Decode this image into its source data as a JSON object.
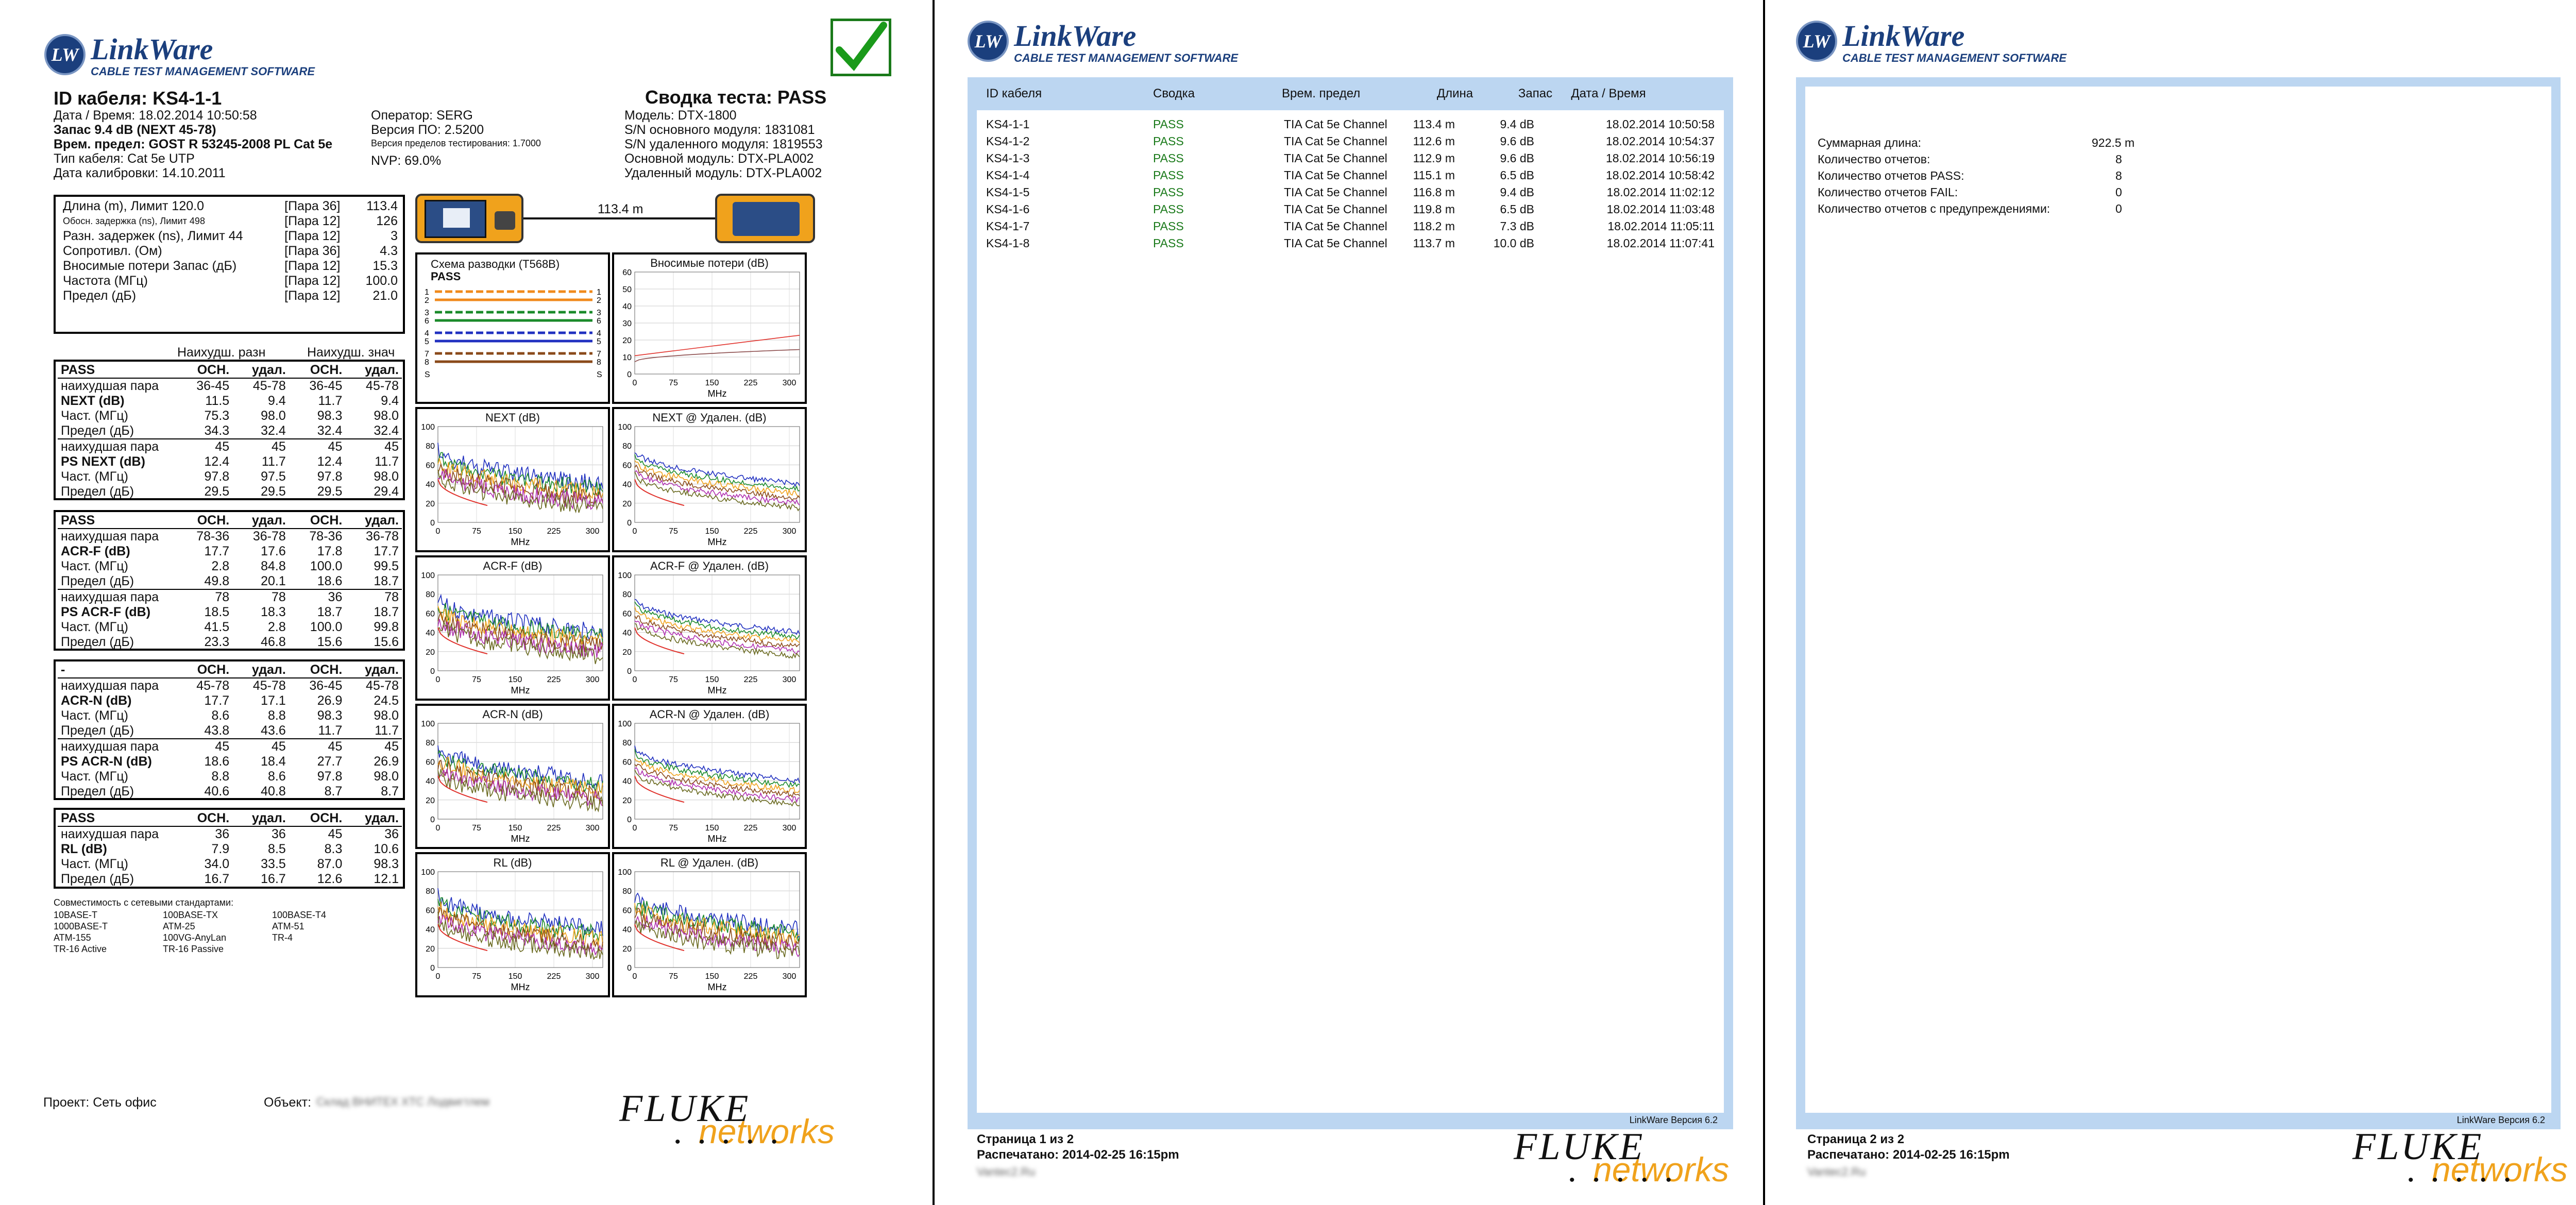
{
  "brand": {
    "name": "LinkWare",
    "logo_letters": "LW",
    "subtitle": "CABLE TEST MANAGEMENT SOFTWARE",
    "fluke": "FLUKE",
    "networks": "networks",
    "dots": "• • • • •"
  },
  "p1": {
    "cable_id": "ID кабеля: KS4-1-1",
    "datetime": "Дата / Время: 18.02.2014 10:50:58",
    "margin": "Запас 9.4 dB (NEXT 45-78)",
    "limit": "Врем. предел: GOST R 53245-2008 PL Cat 5e",
    "cable_type": "Тип кабеля: Cat 5e UTP",
    "cal_date": "Дата калибровки: 14.10.2011",
    "operator": "Оператор: SERG",
    "sw_ver": "Версия ПО: 2.5200",
    "limit_ver": "Версия пределов тестирования: 1.7000",
    "nvp": "NVP: 69.0%",
    "summary": "Сводка теста: PASS",
    "model": "Модель: DTX-1800",
    "main_sn": "S/N основного модуля: 1831081",
    "remote_sn": "S/N удаленного модуля: 1819553",
    "main_mod": "Основной модуль: DTX-PLA002",
    "remote_mod": "Удаленный модуль: DTX-PLA002",
    "length_label": "113.4 m",
    "summary_rows": [
      [
        "Длина (m), Лимит 120.0",
        "[Пара 36]",
        "113.4"
      ],
      [
        "Обосн. задержка (ns), Лимит 498",
        "[Пара 12]",
        "126"
      ],
      [
        "Разн. задержек (ns), Лимит 44",
        "[Пара 12]",
        "3"
      ],
      [
        "Сопротивл. (Ом)",
        "[Пара 36]",
        "4.3"
      ],
      [
        "",
        "",
        ""
      ],
      [
        "Вносимые потери Запас (дБ)",
        "[Пара 12]",
        "15.3"
      ],
      [
        "Частота (МГц)",
        "[Пара 12]",
        "100.0"
      ],
      [
        "Предел (дБ)",
        "[Пара 12]",
        "21.0"
      ]
    ],
    "worst_margin": "Наихудш. разн",
    "worst_value": "Наихудш. знач",
    "groups": [
      {
        "rows": [
          [
            "PASS",
            "ОСН.",
            "удал.",
            "ОСН.",
            "удал."
          ],
          [
            "наихудшая пара",
            "36-45",
            "45-78",
            "36-45",
            "45-78"
          ],
          [
            "NEXT (dB)",
            "11.5",
            "9.4",
            "11.7",
            "9.4"
          ],
          [
            "Част. (МГц)",
            "75.3",
            "98.0",
            "98.3",
            "98.0"
          ],
          [
            "Предел (дБ)",
            "34.3",
            "32.4",
            "32.4",
            "32.4"
          ],
          [
            "наихудшая пара",
            "45",
            "45",
            "45",
            "45"
          ],
          [
            "PS NEXT (dB)",
            "12.4",
            "11.7",
            "12.4",
            "11.7"
          ],
          [
            "Част. (МГц)",
            "97.8",
            "97.5",
            "97.8",
            "98.0"
          ],
          [
            "Предел (дБ)",
            "29.5",
            "29.5",
            "29.5",
            "29.4"
          ]
        ]
      },
      {
        "rows": [
          [
            "PASS",
            "ОСН.",
            "удал.",
            "ОСН.",
            "удал."
          ],
          [
            "наихудшая пара",
            "78-36",
            "36-78",
            "78-36",
            "36-78"
          ],
          [
            "ACR-F (dB)",
            "17.7",
            "17.6",
            "17.8",
            "17.7"
          ],
          [
            "Част. (МГц)",
            "2.8",
            "84.8",
            "100.0",
            "99.5"
          ],
          [
            "Предел (дБ)",
            "49.8",
            "20.1",
            "18.6",
            "18.7"
          ],
          [
            "наихудшая пара",
            "78",
            "78",
            "36",
            "78"
          ],
          [
            "PS ACR-F (dB)",
            "18.5",
            "18.3",
            "18.7",
            "18.7"
          ],
          [
            "Част. (МГц)",
            "41.5",
            "2.8",
            "100.0",
            "99.8"
          ],
          [
            "Предел (дБ)",
            "23.3",
            "46.8",
            "15.6",
            "15.6"
          ]
        ]
      },
      {
        "rows": [
          [
            "-",
            "ОСН.",
            "удал.",
            "ОСН.",
            "удал."
          ],
          [
            "наихудшая пара",
            "45-78",
            "45-78",
            "36-45",
            "45-78"
          ],
          [
            "ACR-N (dB)",
            "17.7",
            "17.1",
            "26.9",
            "24.5"
          ],
          [
            "Част. (МГц)",
            "8.6",
            "8.8",
            "98.3",
            "98.0"
          ],
          [
            "Предел (дБ)",
            "43.8",
            "43.6",
            "11.7",
            "11.7"
          ],
          [
            "наихудшая пара",
            "45",
            "45",
            "45",
            "45"
          ],
          [
            "PS ACR-N (dB)",
            "18.6",
            "18.4",
            "27.7",
            "26.9"
          ],
          [
            "Част. (МГц)",
            "8.8",
            "8.6",
            "97.8",
            "98.0"
          ],
          [
            "Предел (дБ)",
            "40.6",
            "40.8",
            "8.7",
            "8.7"
          ]
        ]
      },
      {
        "rows": [
          [
            "PASS",
            "ОСН.",
            "удал.",
            "ОСН.",
            "удал."
          ],
          [
            "наихудшая пара",
            "36",
            "36",
            "45",
            "36"
          ],
          [
            "RL (dB)",
            "7.9",
            "8.5",
            "8.3",
            "10.6"
          ],
          [
            "Част. (МГц)",
            "34.0",
            "33.5",
            "87.0",
            "98.3"
          ],
          [
            "Предел (дБ)",
            "16.7",
            "16.7",
            "12.6",
            "12.1"
          ]
        ]
      }
    ],
    "compat_title": "Совместимость с сетевыми стандартами:",
    "compat": [
      [
        "10BASE-T",
        "100BASE-TX",
        "100BASE-T4"
      ],
      [
        "1000BASE-T",
        "ATM-25",
        "ATM-51"
      ],
      [
        "ATM-155",
        "100VG-AnyLan",
        "TR-4"
      ],
      [
        "TR-16 Active",
        "TR-16 Passive",
        ""
      ]
    ],
    "project": "Проект: Сеть офис",
    "object_label": "Объект:",
    "object_value": "Склад ВНИТЕХ ХТС Лодвигтлем",
    "wiremap": {
      "title": "Схема разводки (T568B)",
      "status": "PASS",
      "pins": [
        "1",
        "2",
        "3",
        "6",
        "4",
        "5",
        "7",
        "8",
        "S"
      ]
    },
    "charts": [
      {
        "title": "Вносимые потери (dB)",
        "yticks": [
          "60",
          "50",
          "40",
          "30",
          "20",
          "10",
          "0"
        ],
        "xticks": [
          "0",
          "75",
          "150",
          "225",
          "300"
        ],
        "xlabel": "MHz"
      },
      {
        "title": "NEXT (dB)",
        "yticks": [
          "100",
          "80",
          "60",
          "40",
          "20",
          "0"
        ],
        "xticks": [
          "0",
          "75",
          "150",
          "225",
          "300"
        ],
        "xlabel": "MHz"
      },
      {
        "title": "NEXT @ Удален. (dB)",
        "yticks": [
          "100",
          "80",
          "60",
          "40",
          "20",
          "0"
        ],
        "xticks": [
          "0",
          "75",
          "150",
          "225",
          "300"
        ],
        "xlabel": "MHz"
      },
      {
        "title": "ACR-F (dB)",
        "yticks": [
          "100",
          "80",
          "60",
          "40",
          "20",
          "0"
        ],
        "xticks": [
          "0",
          "75",
          "150",
          "225",
          "300"
        ],
        "xlabel": "MHz"
      },
      {
        "title": "ACR-F @ Удален. (dB)",
        "yticks": [
          "100",
          "80",
          "60",
          "40",
          "20",
          "0"
        ],
        "xticks": [
          "0",
          "75",
          "150",
          "225",
          "300"
        ],
        "xlabel": "MHz"
      },
      {
        "title": "ACR-N (dB)",
        "yticks": [
          "100",
          "80",
          "60",
          "40",
          "20",
          "0"
        ],
        "xticks": [
          "0",
          "75",
          "150",
          "225",
          "300"
        ],
        "xlabel": "MHz"
      },
      {
        "title": "ACR-N @ Удален. (dB)",
        "yticks": [
          "100",
          "80",
          "60",
          "40",
          "20",
          "0"
        ],
        "xticks": [
          "0",
          "75",
          "150",
          "225",
          "300"
        ],
        "xlabel": "MHz"
      },
      {
        "title": "RL (dB)",
        "yticks": [
          "100",
          "80",
          "60",
          "40",
          "20",
          "0"
        ],
        "xticks": [
          "0",
          "75",
          "150",
          "225",
          "300"
        ],
        "xlabel": "MHz"
      },
      {
        "title": "RL @ Удален. (dB)",
        "yticks": [
          "100",
          "80",
          "60",
          "40",
          "20",
          "0"
        ],
        "xticks": [
          "0",
          "75",
          "150",
          "225",
          "300"
        ],
        "xlabel": "MHz"
      }
    ],
    "colors": {
      "pass": "#1a7a1a",
      "limit": "#e0302a",
      "brand": "#1b3f7d",
      "frame": "#bcd6f1",
      "fluke_orange": "#f0a21c"
    }
  },
  "p2": {
    "headers": [
      "ID кабеля",
      "Сводка",
      "Врем. предел",
      "Длина",
      "Запас",
      "Дата / Время"
    ],
    "rows": [
      [
        "KS4-1-1",
        "PASS",
        "TIA Cat 5e Channel",
        "113.4 m",
        "9.4 dB",
        "18.02.2014 10:50:58"
      ],
      [
        "KS4-1-2",
        "PASS",
        "TIA Cat 5e Channel",
        "112.6 m",
        "9.6 dB",
        "18.02.2014 10:54:37"
      ],
      [
        "KS4-1-3",
        "PASS",
        "TIA Cat 5e Channel",
        "112.9 m",
        "9.6 dB",
        "18.02.2014 10:56:19"
      ],
      [
        "KS4-1-4",
        "PASS",
        "TIA Cat 5e Channel",
        "115.1 m",
        "6.5 dB",
        "18.02.2014 10:58:42"
      ],
      [
        "KS4-1-5",
        "PASS",
        "TIA Cat 5e Channel",
        "116.8 m",
        "9.4 dB",
        "18.02.2014 11:02:12"
      ],
      [
        "KS4-1-6",
        "PASS",
        "TIA Cat 5e Channel",
        "119.8 m",
        "6.5 dB",
        "18.02.2014 11:03:48"
      ],
      [
        "KS4-1-7",
        "PASS",
        "TIA Cat 5e Channel",
        "118.2 m",
        "7.3 dB",
        "18.02.2014 11:05:11"
      ],
      [
        "KS4-1-8",
        "PASS",
        "TIA Cat 5e Channel",
        "113.7 m",
        "10.0 dB",
        "18.02.2014 11:07:41"
      ]
    ],
    "version": "LinkWare Версия 6.2",
    "page": "Страница 1 из 2",
    "printed": "Распечатано: 2014-02-25 16:15pm",
    "user": "Vantec2.Ru"
  },
  "p3": {
    "stats": [
      [
        "Суммарная длина:",
        "922.5 m"
      ],
      [
        "Количество отчетов:",
        "8"
      ],
      [
        "Количество отчетов PASS:",
        "8"
      ],
      [
        "Количество отчетов FAIL:",
        "0"
      ],
      [
        "Количество отчетов с предупреждениями:",
        "0"
      ]
    ],
    "version": "LinkWare Версия 6.2",
    "page": "Страница 2 из 2",
    "printed": "Распечатано: 2014-02-25 16:15pm",
    "user": "Vantec2.Ru"
  }
}
